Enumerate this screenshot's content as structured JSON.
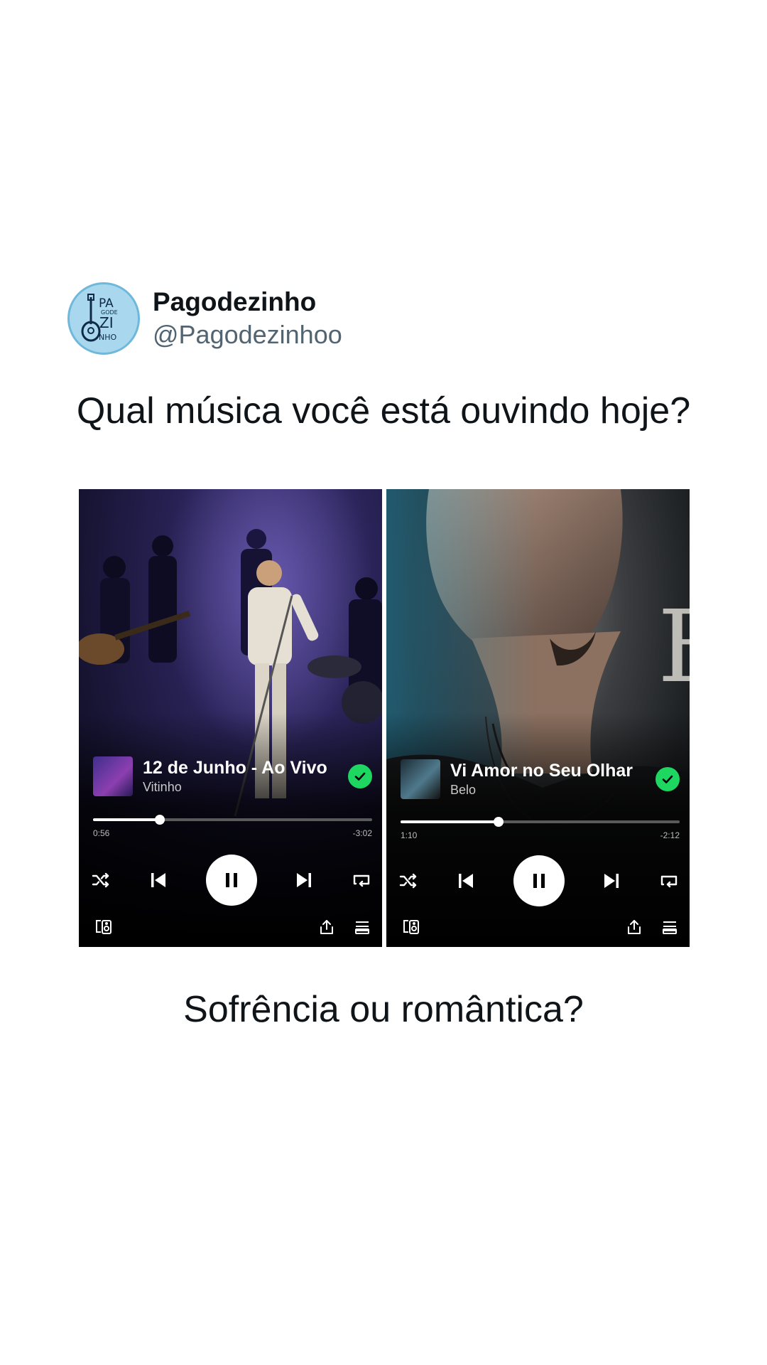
{
  "author": {
    "display_name": "Pagodezinho",
    "handle": "@Pagodezinhoo",
    "avatar_logo_text": "PA GODE ZI NHO"
  },
  "question": "Qual música você está ouvindo hoje?",
  "caption": "Sofrência ou romântica?",
  "players": [
    {
      "track_title": "12 de Junho - Ao Vivo",
      "artist": "Vitinho",
      "elapsed": "0:56",
      "remaining": "-3:02",
      "progress_fraction": 0.24,
      "saved_icon": "check-circle-icon",
      "accent": "#1ed760"
    },
    {
      "track_title": "Vi Amor no Seu Olhar",
      "artist": "Belo",
      "elapsed": "1:10",
      "remaining": "-2:12",
      "progress_fraction": 0.35,
      "saved_icon": "check-circle-icon",
      "accent": "#1ed760"
    }
  ],
  "controls": [
    "shuffle-icon",
    "previous-icon",
    "pause-icon",
    "next-icon",
    "repeat-icon"
  ],
  "bottom_icons": [
    "connect-device-icon",
    "share-icon",
    "queue-icon"
  ]
}
